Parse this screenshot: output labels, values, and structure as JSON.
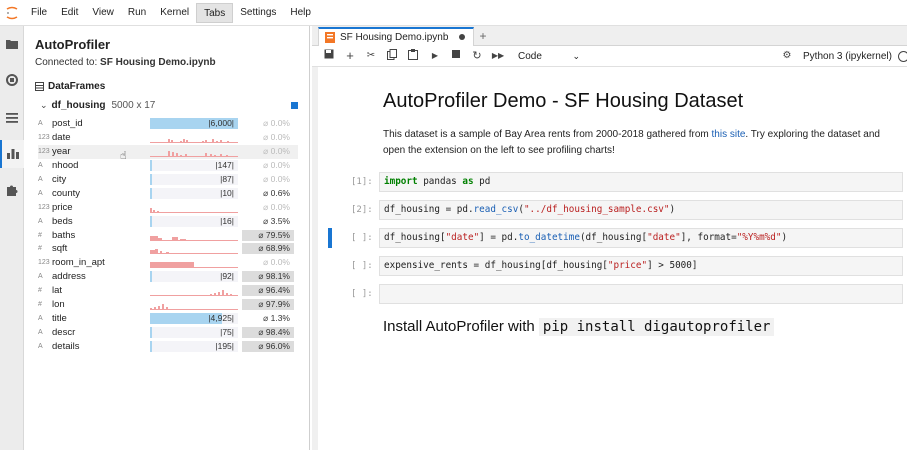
{
  "menu": {
    "items": [
      "File",
      "Edit",
      "View",
      "Run",
      "Kernel",
      "Tabs",
      "Settings",
      "Help"
    ],
    "active_index": 5
  },
  "activity_icons": [
    "folder-icon",
    "running-icon",
    "list-icon",
    "profiler-chart-icon",
    "extension-puzzle-icon"
  ],
  "sidepanel": {
    "title": "AutoProfiler",
    "connected_prefix": "Connected to:",
    "connected_file": "SF Housing Demo.ipynb",
    "section": "DataFrames",
    "dataframe": {
      "name": "df_housing",
      "dims": "5000 x 17"
    },
    "columns": [
      {
        "type": "A",
        "name": "post_id",
        "viz": "bar",
        "fill": 1.0,
        "label": "|6,000|",
        "missing": "⌀ 0.0%",
        "missing_level": "none"
      },
      {
        "type": "123",
        "name": "date",
        "viz": "hist",
        "label": "",
        "missing": "⌀ 0.0%",
        "missing_level": "none"
      },
      {
        "type": "123",
        "name": "year",
        "viz": "hist",
        "label": "",
        "missing": "⌀ 0.0%",
        "missing_level": "none",
        "hover": true
      },
      {
        "type": "A",
        "name": "nhood",
        "viz": "bar",
        "fill": 0.02,
        "label": "|147|",
        "missing": "⌀ 0.0%",
        "missing_level": "none"
      },
      {
        "type": "A",
        "name": "city",
        "viz": "bar",
        "fill": 0.02,
        "label": "|87|",
        "missing": "⌀ 0.0%",
        "missing_level": "none"
      },
      {
        "type": "A",
        "name": "county",
        "viz": "bar",
        "fill": 0.02,
        "label": "|10|",
        "missing": "⌀ 0.6%",
        "missing_level": "mid"
      },
      {
        "type": "123",
        "name": "price",
        "viz": "hist",
        "label": "",
        "missing": "⌀ 0.0%",
        "missing_level": "none"
      },
      {
        "type": "A",
        "name": "beds",
        "viz": "bar",
        "fill": 0.02,
        "label": "|16|",
        "missing": "⌀ 3.5%",
        "missing_level": "mid"
      },
      {
        "type": "#",
        "name": "baths",
        "viz": "hist",
        "label": "",
        "missing": "⌀ 79.5%",
        "missing_level": "hi"
      },
      {
        "type": "#",
        "name": "sqft",
        "viz": "hist",
        "label": "",
        "missing": "⌀ 68.9%",
        "missing_level": "hi"
      },
      {
        "type": "123",
        "name": "room_in_apt",
        "viz": "hist",
        "label": "",
        "missing": "⌀ 0.0%",
        "missing_level": "none"
      },
      {
        "type": "A",
        "name": "address",
        "viz": "bar",
        "fill": 0.02,
        "label": "|92|",
        "missing": "⌀ 98.1%",
        "missing_level": "hi"
      },
      {
        "type": "#",
        "name": "lat",
        "viz": "hist",
        "label": "",
        "missing": "⌀ 96.4%",
        "missing_level": "hi"
      },
      {
        "type": "#",
        "name": "lon",
        "viz": "hist",
        "label": "",
        "missing": "⌀ 97.9%",
        "missing_level": "hi"
      },
      {
        "type": "A",
        "name": "title",
        "viz": "bar",
        "fill": 0.82,
        "label": "|4,925|",
        "missing": "⌀ 1.3%",
        "missing_level": "mid"
      },
      {
        "type": "A",
        "name": "descr",
        "viz": "bar",
        "fill": 0.02,
        "label": "|75|",
        "missing": "⌀ 98.4%",
        "missing_level": "hi"
      },
      {
        "type": "A",
        "name": "details",
        "viz": "bar",
        "fill": 0.02,
        "label": "|195|",
        "missing": "⌀ 96.0%",
        "missing_level": "hi"
      }
    ]
  },
  "notebook": {
    "tab_name": "SF Housing Demo.ipynb",
    "toolbar": {
      "cell_type": "Code",
      "kernel": "Python 3 (ipykernel)"
    },
    "md_title": "AutoProfiler Demo - SF Housing Dataset",
    "md_para_a": "This dataset is a sample of Bay Area rents from 2000-2018 gathered from ",
    "md_para_link": "this site",
    "md_para_b": ". Try exploring the dataset and open the extension on the left to see profiling charts!",
    "cells": [
      {
        "prompt": "[1]:",
        "code": "import pandas as pd"
      },
      {
        "prompt": "[2]:",
        "code": "df_housing = pd.read_csv(\"../df_housing_sample.csv\")"
      },
      {
        "prompt": "[ ]:",
        "code": "df_housing[\"date\"] = pd.to_datetime(df_housing[\"date\"], format=\"%Y%m%d\")",
        "selected": true
      },
      {
        "prompt": "[ ]:",
        "code": "expensive_rents = df_housing[df_housing[\"price\"] > 5000]"
      },
      {
        "prompt": "[ ]:",
        "code": ""
      }
    ],
    "install_text": "Install AutoProfiler with ",
    "install_cmd": "pip install digautoprofiler"
  },
  "colors": {
    "accent": "#1976d2",
    "bar_blue": "#a8d4f0",
    "hist_red": "#f0a0a0"
  }
}
